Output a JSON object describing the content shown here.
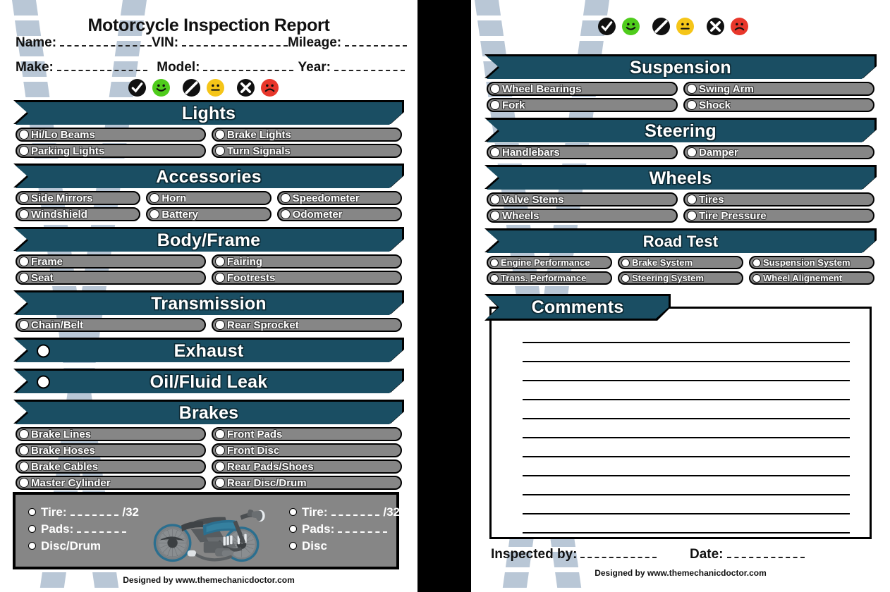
{
  "document": {
    "title": "Motorcycle Inspection Report",
    "credit": "Designed by www.themechanicdoctor.com"
  },
  "header_fields": {
    "name": "Name:",
    "vin": "VIN:",
    "mileage": "Mileage:",
    "make": "Make:",
    "model": "Model:",
    "year": "Year:"
  },
  "legend": {
    "items": [
      {
        "mark": "check-mark",
        "face": "smiley-happy",
        "face_color": "#4fcc1c"
      },
      {
        "mark": "slash-mark",
        "face": "smiley-neutral",
        "face_color": "#f5c518"
      },
      {
        "mark": "cross-mark",
        "face": "smiley-sad",
        "face_color": "#e8372b"
      }
    ]
  },
  "colors": {
    "banner": "#1a4e63",
    "pill": "#868686",
    "tread": "#b9c7d6",
    "good": "#4fcc1c",
    "caution": "#f5c518",
    "bad": "#e8372b",
    "tank": "#2b6f8f"
  },
  "left_page": {
    "sections": [
      {
        "title": "Lights",
        "columns": [
          [
            "Hi/Lo Beams",
            "Parking Lights"
          ],
          [
            "Brake Lights",
            "Turn Signals"
          ]
        ]
      },
      {
        "title": "Accessories",
        "columns": [
          [
            "Side Mirrors",
            "Windshield"
          ],
          [
            "Horn",
            "Battery"
          ],
          [
            "Speedometer",
            "Odometer"
          ]
        ]
      },
      {
        "title": "Body/Frame",
        "columns": [
          [
            "Frame",
            "Seat"
          ],
          [
            "Fairing",
            "Footrests"
          ]
        ]
      },
      {
        "title": "Transmission",
        "columns": [
          [
            "Chain/Belt"
          ],
          [
            "Rear Sprocket"
          ]
        ]
      },
      {
        "title": "Exhaust",
        "inline_checkbox": true,
        "columns": []
      },
      {
        "title": "Oil/Fluid Leak",
        "inline_checkbox": true,
        "columns": []
      },
      {
        "title": "Brakes",
        "columns": [
          [
            "Brake Lines",
            "Brake Hoses",
            "Brake Cables",
            "Master Cylinder"
          ],
          [
            "Front Pads",
            "Front Disc",
            "Rear Pads/Shoes",
            "Rear Disc/Drum"
          ]
        ]
      }
    ],
    "measurements": {
      "left": {
        "tire_label": "Tire:",
        "tire_unit": "/32",
        "pads_label": "Pads:",
        "third_label": "Disc/Drum"
      },
      "right": {
        "tire_label": "Tire:",
        "tire_unit": "/32",
        "pads_label": "Pads:",
        "third_label": "Disc"
      },
      "illustration": "motorcycle-illustration"
    }
  },
  "right_page": {
    "sections": [
      {
        "title": "Suspension",
        "columns": [
          [
            "Wheel Bearings",
            "Fork"
          ],
          [
            "Swing Arm",
            "Shock"
          ]
        ]
      },
      {
        "title": "Steering",
        "columns": [
          [
            "Handlebars"
          ],
          [
            "Damper"
          ]
        ]
      },
      {
        "title": "Wheels",
        "columns": [
          [
            "Valve Stems",
            "Wheels"
          ],
          [
            "Tires",
            "Tire Pressure"
          ]
        ]
      },
      {
        "title": "Road Test",
        "small": true,
        "columns": [
          [
            "Engine Performance",
            "Trans. Performance"
          ],
          [
            "Brake System",
            "Steering System"
          ],
          [
            "Suspension System",
            "Wheel Alignement"
          ]
        ]
      }
    ],
    "comments": {
      "title": "Comments",
      "line_count": 11
    },
    "signature": {
      "inspected_by": "Inspected by:",
      "date": "Date:"
    }
  }
}
